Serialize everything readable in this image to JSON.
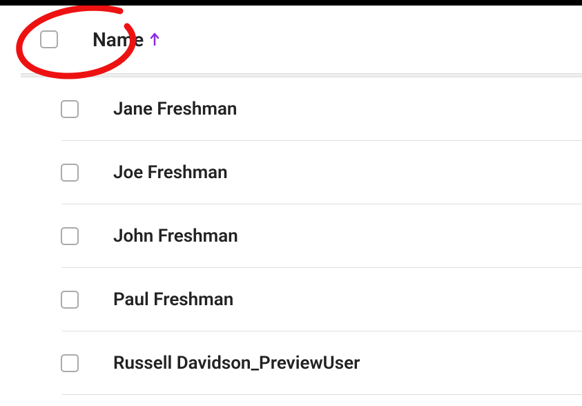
{
  "table": {
    "header": {
      "column_label": "Name",
      "sort_direction": "asc"
    },
    "rows": [
      {
        "name": "Jane Freshman"
      },
      {
        "name": "Joe Freshman"
      },
      {
        "name": "John Freshman"
      },
      {
        "name": "Paul Freshman"
      },
      {
        "name": "Russell Davidson_PreviewUser"
      }
    ]
  },
  "colors": {
    "annotation": "#e11",
    "sort_arrow": "#8a2be2"
  }
}
